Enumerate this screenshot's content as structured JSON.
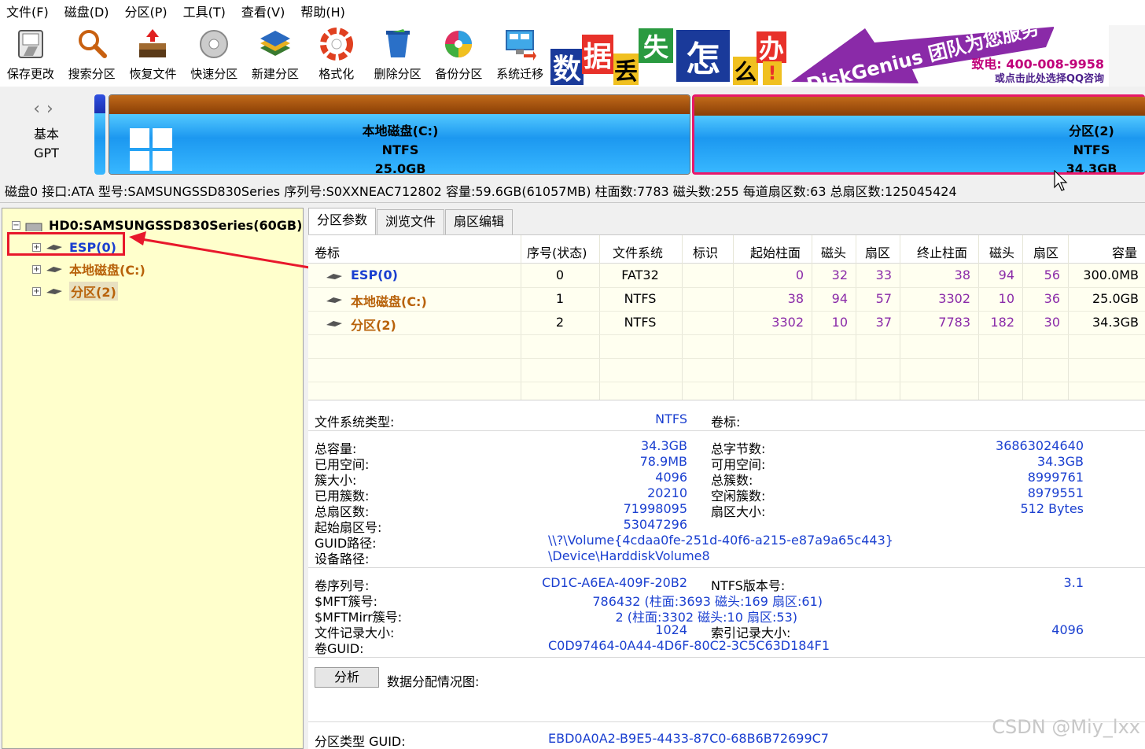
{
  "menu": [
    "文件(F)",
    "磁盘(D)",
    "分区(P)",
    "工具(T)",
    "查看(V)",
    "帮助(H)"
  ],
  "toolbar": [
    {
      "label": "保存更改",
      "icon": "save-icon"
    },
    {
      "label": "搜索分区",
      "icon": "search-icon"
    },
    {
      "label": "恢复文件",
      "icon": "recover-icon"
    },
    {
      "label": "快速分区",
      "icon": "quick-partition-icon"
    },
    {
      "label": "新建分区",
      "icon": "new-partition-icon"
    },
    {
      "label": "格式化",
      "icon": "format-icon"
    },
    {
      "label": "删除分区",
      "icon": "delete-icon"
    },
    {
      "label": "备份分区",
      "icon": "backup-icon"
    },
    {
      "label": "系统迁移",
      "icon": "migrate-icon"
    }
  ],
  "banner": {
    "chars": [
      "数",
      "据",
      "丢",
      "失",
      "怎",
      "么",
      "办",
      "!"
    ],
    "slogan": "DiskGenius 团队为您服务",
    "phone": "致电: 400-008-9958",
    "qq": "或点击此处选择QQ咨询"
  },
  "disk_nav": {
    "type": "基本",
    "scheme": "GPT"
  },
  "diskmap": {
    "c": {
      "name": "本地磁盘(C:)",
      "fs": "NTFS",
      "size": "25.0GB"
    },
    "p2": {
      "name": "分区(2)",
      "fs": "NTFS",
      "size": "34.3GB"
    }
  },
  "disk_info": "磁盘0 接口:ATA  型号:SAMSUNGSSD830Series  序列号:S0XXNEAC712802  容量:59.6GB(61057MB)  柱面数:7783  磁头数:255  每道扇区数:63  总扇区数:125045424",
  "tree": {
    "disk": "HD0:SAMSUNGSSD830Series(60GB)",
    "partitions": [
      "ESP(0)",
      "本地磁盘(C:)",
      "分区(2)"
    ]
  },
  "tabs": [
    "分区参数",
    "浏览文件",
    "扇区编辑"
  ],
  "table": {
    "headers": [
      "卷标",
      "序号(状态)",
      "文件系统",
      "标识",
      "起始柱面",
      "磁头",
      "扇区",
      "终止柱面",
      "磁头",
      "扇区",
      "容量"
    ],
    "rows": [
      [
        "ESP(0)",
        "0",
        "FAT32",
        "",
        "0",
        "32",
        "33",
        "38",
        "94",
        "56",
        "300.0MB"
      ],
      [
        "本地磁盘(C:)",
        "1",
        "NTFS",
        "",
        "38",
        "94",
        "57",
        "3302",
        "10",
        "36",
        "25.0GB"
      ],
      [
        "分区(2)",
        "2",
        "NTFS",
        "",
        "3302",
        "10",
        "37",
        "7783",
        "182",
        "30",
        "34.3GB"
      ]
    ]
  },
  "details": {
    "fs_type_label": "文件系统类型:",
    "fs_type": "NTFS",
    "vol_label_label": "卷标:",
    "total_cap_label": "总容量:",
    "total_cap": "34.3GB",
    "total_bytes_label": "总字节数:",
    "total_bytes": "36863024640",
    "used_label": "已用空间:",
    "used": "78.9MB",
    "free_label": "可用空间:",
    "free": "34.3GB",
    "cluster_label": "簇大小:",
    "cluster": "4096",
    "total_clusters_label": "总簇数:",
    "total_clusters": "8999761",
    "used_clusters_label": "已用簇数:",
    "used_clusters": "20210",
    "free_clusters_label": "空闲簇数:",
    "free_clusters": "8979551",
    "total_sectors_label": "总扇区数:",
    "total_sectors": "71998095",
    "sector_size_label": "扇区大小:",
    "sector_size": "512 Bytes",
    "start_sector_label": "起始扇区号:",
    "start_sector": "53047296",
    "guid_path_label": "GUID路径:",
    "guid_path": "\\\\?\\Volume{4cdaa0fe-251d-40f6-a215-e87a9a65c443}",
    "device_path_label": "设备路径:",
    "device_path": "\\Device\\HarddiskVolume8",
    "serial_label": "卷序列号:",
    "serial": "CD1C-A6EA-409F-20B2",
    "ntfs_ver_label": "NTFS版本号:",
    "ntfs_ver": "3.1",
    "mft_label": "$MFT簇号:",
    "mft": "786432 (柱面:3693 磁头:169 扇区:61)",
    "mftmirr_label": "$MFTMirr簇号:",
    "mftmirr": "2 (柱面:3302 磁头:10 扇区:53)",
    "record_size_label": "文件记录大小:",
    "record_size": "1024",
    "index_size_label": "索引记录大小:",
    "index_size": "4096",
    "vol_guid_label": "卷GUID:",
    "vol_guid": "C0D97464-0A44-4D6F-80C2-3C5C63D184F1",
    "analyze_button": "分析",
    "alloc_label": "数据分配情况图:",
    "ptype_guid_label": "分区类型 GUID:",
    "ptype_guid": "EBD0A0A2-B9E5-4433-87C0-68B6B72699C7"
  },
  "watermark": "CSDN @Miy_lxx",
  "colors": {
    "accent_blue": "#1a3fd0",
    "partition_orange": "#b8620a",
    "tree_bg": "#ffffcc",
    "highlight_red": "#e8182b"
  }
}
